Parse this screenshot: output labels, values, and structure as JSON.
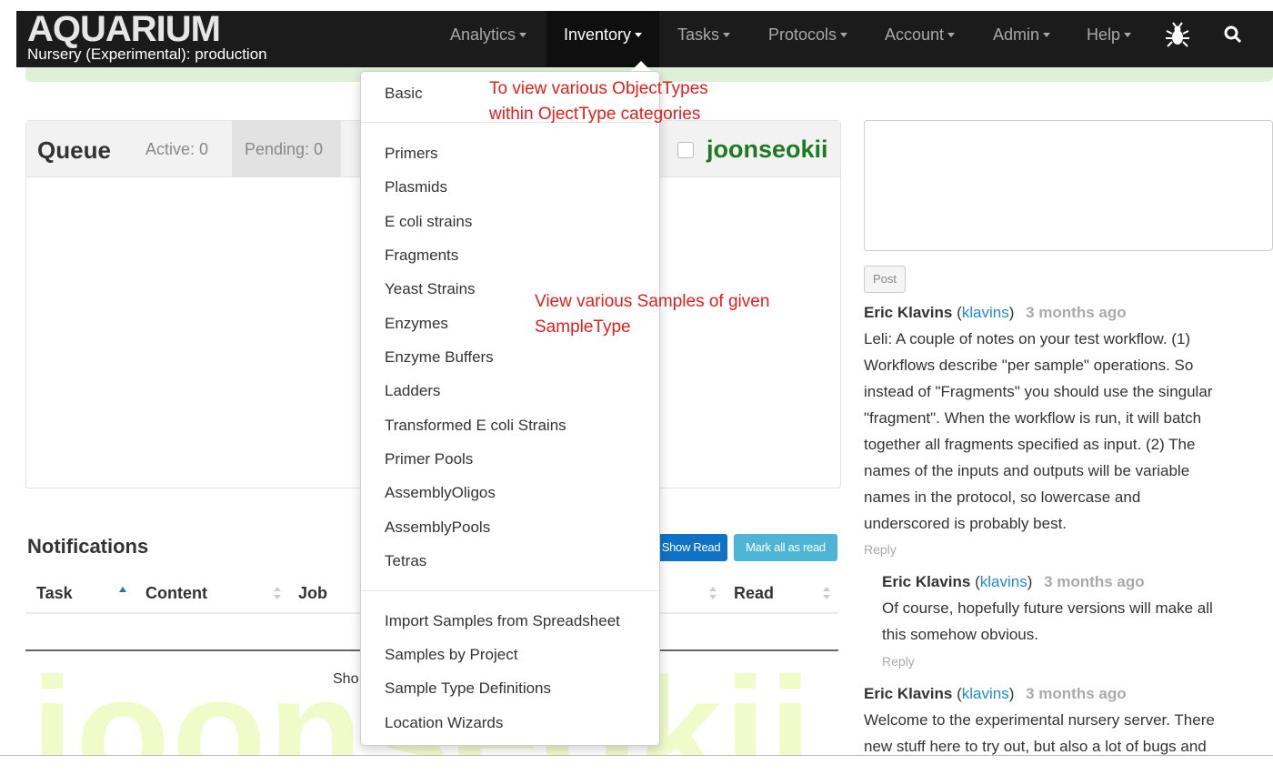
{
  "brand": {
    "title": "AQUARIUM",
    "subtitle": "Nursery (Experimental): production"
  },
  "nav": [
    {
      "label": "Analytics"
    },
    {
      "label": "Inventory"
    },
    {
      "label": "Tasks"
    },
    {
      "label": "Protocols"
    },
    {
      "label": "Account"
    },
    {
      "label": "Admin"
    },
    {
      "label": "Help"
    }
  ],
  "queue": {
    "title": "Queue",
    "tabs": [
      {
        "label": "Active: 0"
      },
      {
        "label": "Pending: 0"
      }
    ],
    "user": "joonseokii"
  },
  "notifications": {
    "title": "Notifications",
    "show_read": "Show Read",
    "mark_all": "Mark all as read",
    "columns": [
      "Task",
      "Content",
      "Job",
      "Read"
    ],
    "showing_fragment": "Sho"
  },
  "watermark": "joonseokii",
  "dropdown": {
    "basic": "Basic",
    "object_types": [
      "Primers",
      "Plasmids",
      "E coli strains",
      "Fragments",
      "Yeast Strains",
      "Enzymes",
      "Enzyme Buffers",
      "Ladders",
      "Transformed E coli Strains",
      "Primer Pools",
      "AssemblyOligos",
      "AssemblyPools",
      "Tetras"
    ],
    "tools": [
      "Import Samples from Spreadsheet",
      "Samples by Project",
      "Sample Type Definitions",
      "Location Wizards"
    ]
  },
  "annotations": {
    "object_types": [
      "To view various ObjectTypes",
      "within OjectType categories"
    ],
    "samples": [
      "View various Samples of given",
      "SampleType"
    ]
  },
  "post": {
    "button": "Post"
  },
  "comments": [
    {
      "author": "Eric Klavins",
      "handle": "klavins",
      "ago": "3 months ago",
      "lines": [
        "Leli: A couple of notes on your test workflow. (1)",
        "Workflows describe \"per sample\" operations. So",
        "instead of \"Fragments\" you should use the singular",
        "\"fragment\". When the workflow is run, it will batch",
        "together all fragments specified as input. (2) The",
        "names of the inputs and outputs will be variable",
        "names in the protocol, so lowercase and",
        "underscored is probably best."
      ],
      "reply": "Reply"
    },
    {
      "author": "Eric Klavins",
      "handle": "klavins",
      "ago": "3 months ago",
      "lines": [
        "Of course, hopefully future versions will make all",
        "this somehow obvious."
      ],
      "reply": "Reply"
    },
    {
      "author": "Eric Klavins",
      "handle": "klavins",
      "ago": "3 months ago",
      "lines": [
        "Welcome to the experimental nursery server. There",
        "new stuff here to try out, but also a lot of bugs and"
      ]
    }
  ],
  "icons": {
    "bug": "bug-icon",
    "search": "search-icon",
    "sort": "sort-icon",
    "sort_asc": "sort-asc-icon"
  }
}
